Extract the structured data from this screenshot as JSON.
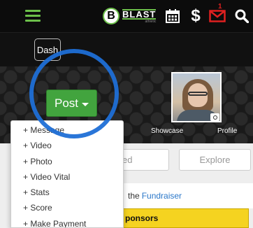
{
  "header": {
    "logo_mark": "B",
    "logo_word": "BLAST",
    "logo_sub": "athletic"
  },
  "navbar": {
    "dash_label": "Dash",
    "dollar": "$",
    "mail_badge": "1"
  },
  "hero": {
    "post_label": "Post",
    "showcase_label": "Showcase",
    "profile_label": "Profile"
  },
  "post_menu": {
    "items": [
      "+ Message",
      "+ Video",
      "+ Photo",
      "+ Video Vital",
      "+ Stats",
      "+ Score",
      "+ Make Payment"
    ]
  },
  "tabs": {
    "followed_label": "ed",
    "explore_label": "Explore"
  },
  "notice": {
    "prefix": "the",
    "link": "Fundraiser"
  },
  "sponsors": {
    "label": "ponsors"
  },
  "colors": {
    "accent_green": "#42a43e",
    "highlight_ring": "#1f6fd6",
    "badge_red": "#e02020",
    "sponsor_yellow": "#f5d320"
  }
}
